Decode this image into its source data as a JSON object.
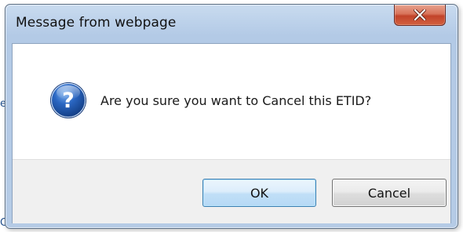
{
  "dialog": {
    "title": "Message from webpage",
    "message": "Are you sure you want to Cancel this ETID?",
    "icon": "question-icon",
    "ok_label": "OK",
    "cancel_label": "Cancel",
    "close_icon": "close-icon"
  },
  "background": {
    "left_char_a": "e",
    "left_char_b": "C"
  },
  "colors": {
    "close_button": "#c9482f",
    "window_frame": "#b5cbe6",
    "ok_button_border": "#3c7fb1",
    "icon_blue": "#1d55a5"
  }
}
